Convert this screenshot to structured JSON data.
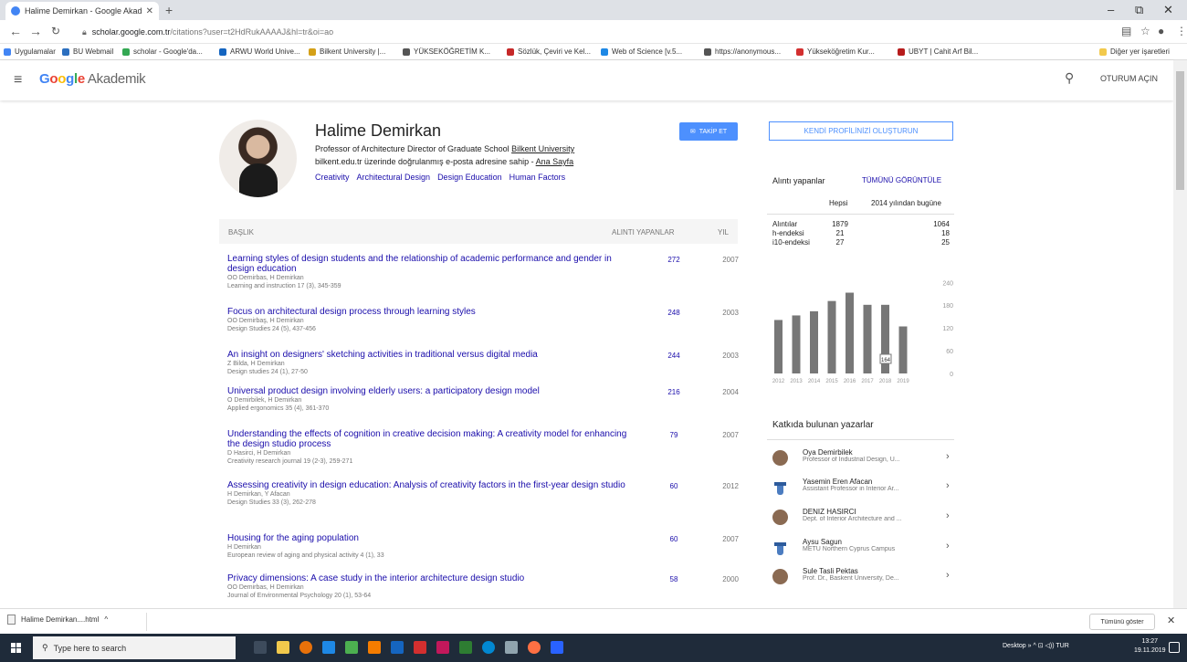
{
  "browser": {
    "tab_title": "Halime Demirkan - Google Akad",
    "url_host": "scholar.google.com.tr",
    "url_path": "/citations?user=t2HdRukAAAAJ&hl=tr&oi=ao",
    "bookmarks": [
      "Uygulamalar",
      "BU Webmail",
      "scholar - Google'da...",
      "ARWU World Unive...",
      "Bilkent University |...",
      "YÜKSEKÖĞRETİM K...",
      "Sözlük, Çeviri ve Kel...",
      "Web of Science [v.5...",
      "https://anonymous...",
      "Yükseköğretim Kur...",
      "UBYT | Cahit Arf Bil...",
      "Diğer yer işaretleri"
    ]
  },
  "header": {
    "logo_google": "Google",
    "logo_sub": "Akademik",
    "signin": "OTURUM AÇIN"
  },
  "profile": {
    "name": "Halime Demirkan",
    "affiliation": "Professor of Architecture Director of Graduate School ",
    "affiliation_link": "Bilkent University",
    "email_text": "bilkent.edu.tr üzerinde doğrulanmış e-posta adresine sahip - ",
    "homepage": "Ana Sayfa",
    "interests": [
      "Creativity",
      "Architectural Design",
      "Design Education",
      "Human Factors"
    ],
    "follow": "TAKİP ET"
  },
  "table": {
    "col_title": "BAŞLIK",
    "col_cited": "ALINTI YAPANLAR",
    "col_year": "YIL",
    "rows": [
      {
        "title": "Learning styles of design students and the relationship of academic performance and gender in design education",
        "authors": "OO Demirbas, H Demirkan",
        "venue": "Learning and instruction 17 (3), 345-359",
        "cited": "272",
        "year": "2007"
      },
      {
        "title": "Focus on architectural design process through learning styles",
        "authors": "OO Demirbaş, H Demirkan",
        "venue": "Design Studies 24 (5), 437-456",
        "cited": "248",
        "year": "2003"
      },
      {
        "title": "An insight on designers' sketching activities in traditional versus digital media",
        "authors": "Z Bilda, H Demirkan",
        "venue": "Design studies 24 (1), 27-50",
        "cited": "244",
        "year": "2003"
      },
      {
        "title": "Universal product design involving elderly users: a participatory design model",
        "authors": "O Demirbilek, H Demirkan",
        "venue": "Applied ergonomics 35 (4), 361-370",
        "cited": "216",
        "year": "2004"
      },
      {
        "title": "Understanding the effects of cognition in creative decision making: A creativity model for enhancing the design studio process",
        "authors": "D Hasirci, H Demirkan",
        "venue": "Creativity research journal 19 (2-3), 259-271",
        "cited": "79",
        "year": "2007"
      },
      {
        "title": "Assessing creativity in design education: Analysis of creativity factors in the first-year design studio",
        "authors": "H Demirkan, Y Afacan",
        "venue": "Design Studies 33 (3), 262-278",
        "cited": "60",
        "year": "2012"
      },
      {
        "title": "Housing for the aging population",
        "authors": "H Demirkan",
        "venue": "European review of aging and physical activity 4 (1), 33",
        "cited": "60",
        "year": "2007"
      },
      {
        "title": "Privacy dimensions: A case study in the interior architecture design studio",
        "authors": "OO Demirbas, H Demirkan",
        "venue": "Journal of Environmental Psychology 20 (1), 53-64",
        "cited": "58",
        "year": "2000"
      }
    ]
  },
  "citations": {
    "create_profile": "KENDİ PROFİLİNİZİ OLUŞTURUN",
    "title": "Alıntı yapanlar",
    "view_all": "TÜMÜNÜ GÖRÜNTÜLE",
    "col_all": "Hepsi",
    "col_since": "2014 yılından bugüne",
    "rows": [
      {
        "label": "Alıntılar",
        "all": "1879",
        "since": "1064"
      },
      {
        "label": "h-endeksi",
        "all": "21",
        "since": "18"
      },
      {
        "label": "i10-endeksi",
        "all": "27",
        "since": "25"
      }
    ]
  },
  "chart_data": {
    "type": "bar",
    "categories": [
      "2012",
      "2013",
      "2014",
      "2015",
      "2016",
      "2017",
      "2018",
      "2019"
    ],
    "values": [
      141,
      153,
      164,
      191,
      213,
      181,
      181,
      124
    ],
    "ylim": [
      0,
      260
    ],
    "yticks": [
      "240",
      "180",
      "120",
      "60",
      "0"
    ],
    "highlight_label": "164",
    "bar_color": "#777777"
  },
  "coauthors": {
    "title": "Katkıda bulunan yazarlar",
    "items": [
      {
        "name": "Oya Demirbilek",
        "affiliation": "Professor of Industrial Design, U...",
        "avatar": "photo"
      },
      {
        "name": "Yasemin Eren Afacan",
        "affiliation": "Assistant Professor in Interior Ar...",
        "avatar": "cap"
      },
      {
        "name": "DENIZ HASIRCI",
        "affiliation": "Dept. of Interior Architecture and ...",
        "avatar": "photo"
      },
      {
        "name": "Aysu Sagun",
        "affiliation": "METU Northern Cyprus Campus",
        "avatar": "cap"
      },
      {
        "name": "Sule Tasli Pektas",
        "affiliation": "Prof. Dr., Baskent University, De...",
        "avatar": "photo"
      }
    ]
  },
  "downloads": {
    "file": "Halime Demirkan....html",
    "show_all": "Tümünü göster"
  },
  "taskbar": {
    "search_placeholder": "Type here to search",
    "tray": "Desktop  »  ^  ⊡  ◁))  TUR",
    "time": "13:27",
    "date": "19.11.2019"
  }
}
